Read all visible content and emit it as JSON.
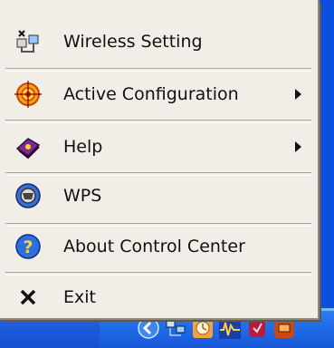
{
  "menu": {
    "items": [
      {
        "label": "Wireless Setting",
        "icon": "wireless-setting-icon",
        "submenu": false
      },
      {
        "label": "Active Configuration",
        "icon": "target-icon",
        "submenu": true
      },
      {
        "label": "Help",
        "icon": "help-book-icon",
        "submenu": true
      },
      {
        "label": "WPS",
        "icon": "wps-icon",
        "submenu": false
      },
      {
        "label": "About Control Center",
        "icon": "question-icon",
        "submenu": false
      },
      {
        "label": "Exit",
        "icon": "close-icon",
        "submenu": false
      }
    ]
  },
  "taskbar": {
    "tray_icons": [
      "chevron-left-icon",
      "network-icon",
      "clock-icon",
      "audio-icon",
      "shield-icon",
      "app-icon"
    ]
  },
  "colors": {
    "menu_bg": "#f1eee7",
    "taskbar": "#1d5fe2"
  }
}
